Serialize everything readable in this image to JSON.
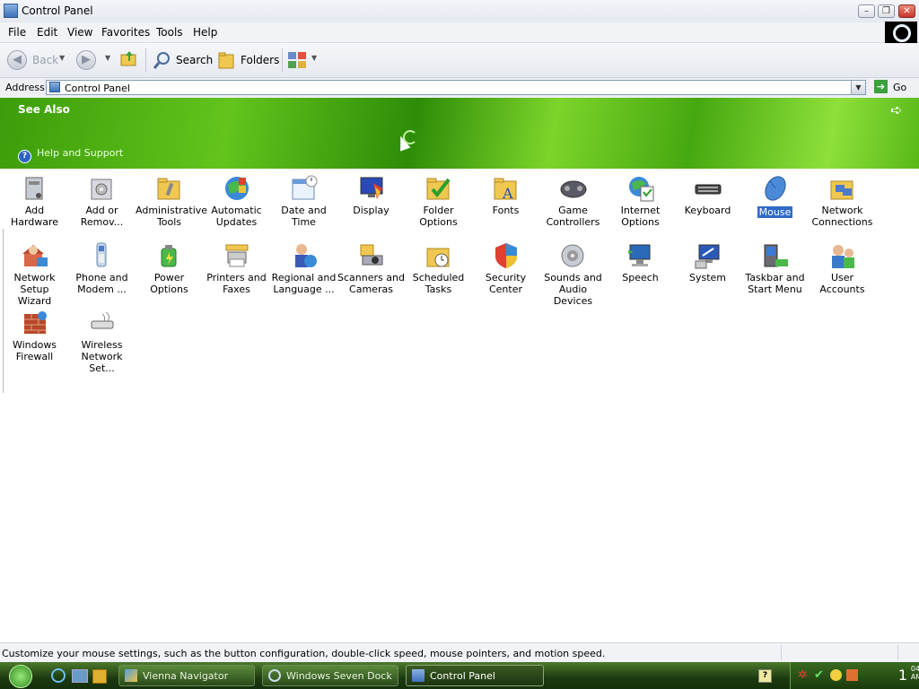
{
  "window": {
    "title": "Control Panel"
  },
  "menu": {
    "file": "File",
    "edit": "Edit",
    "view": "View",
    "favorites": "Favorites",
    "tools": "Tools",
    "help": "Help"
  },
  "toolbar": {
    "back": "Back",
    "search": "Search",
    "folders": "Folders"
  },
  "address": {
    "label": "Address",
    "value": "Control Panel",
    "go": "Go"
  },
  "banner": {
    "see_also": "See Also",
    "help_support": "Help and Support"
  },
  "items": [
    {
      "l1": "Add Hardware",
      "l2": ""
    },
    {
      "l1": "Add or",
      "l2": "Remov..."
    },
    {
      "l1": "Administrative",
      "l2": "Tools"
    },
    {
      "l1": "Automatic",
      "l2": "Updates"
    },
    {
      "l1": "Date and Time",
      "l2": ""
    },
    {
      "l1": "Display",
      "l2": ""
    },
    {
      "l1": "Folder Options",
      "l2": ""
    },
    {
      "l1": "Fonts",
      "l2": ""
    },
    {
      "l1": "Game",
      "l2": "Controllers"
    },
    {
      "l1": "Internet",
      "l2": "Options"
    },
    {
      "l1": "Keyboard",
      "l2": ""
    },
    {
      "l1": "Mouse",
      "l2": ""
    },
    {
      "l1": "Network",
      "l2": "Connections"
    },
    {
      "l1": "Network Setup",
      "l2": "Wizard"
    },
    {
      "l1": "Phone and",
      "l2": "Modem ..."
    },
    {
      "l1": "Power Options",
      "l2": ""
    },
    {
      "l1": "Printers and",
      "l2": "Faxes"
    },
    {
      "l1": "Regional and",
      "l2": "Language ..."
    },
    {
      "l1": "Scanners and",
      "l2": "Cameras"
    },
    {
      "l1": "Scheduled",
      "l2": "Tasks"
    },
    {
      "l1": "Security",
      "l2": "Center"
    },
    {
      "l1": "Sounds and",
      "l2": "Audio Devices"
    },
    {
      "l1": "Speech",
      "l2": ""
    },
    {
      "l1": "System",
      "l2": ""
    },
    {
      "l1": "Taskbar and",
      "l2": "Start Menu"
    },
    {
      "l1": "User Accounts",
      "l2": ""
    },
    {
      "l1": "Windows",
      "l2": "Firewall"
    },
    {
      "l1": "Wireless",
      "l2": "Network Set..."
    }
  ],
  "status": {
    "text": "Customize your mouse settings, such as the button configuration, double-click speed, mouse pointers, and motion speed."
  },
  "taskbar": {
    "buttons": [
      {
        "label": "Vienna Navigator"
      },
      {
        "label": "Windows Seven Dock"
      },
      {
        "label": "Control Panel"
      }
    ],
    "clock_hour": "1",
    "clock_min": "04",
    "clock_ampm": "AM"
  },
  "colors": {
    "banner_green": "#3c9c0a",
    "selection": "#316ac5",
    "taskbar_green": "#2a4a1a"
  }
}
